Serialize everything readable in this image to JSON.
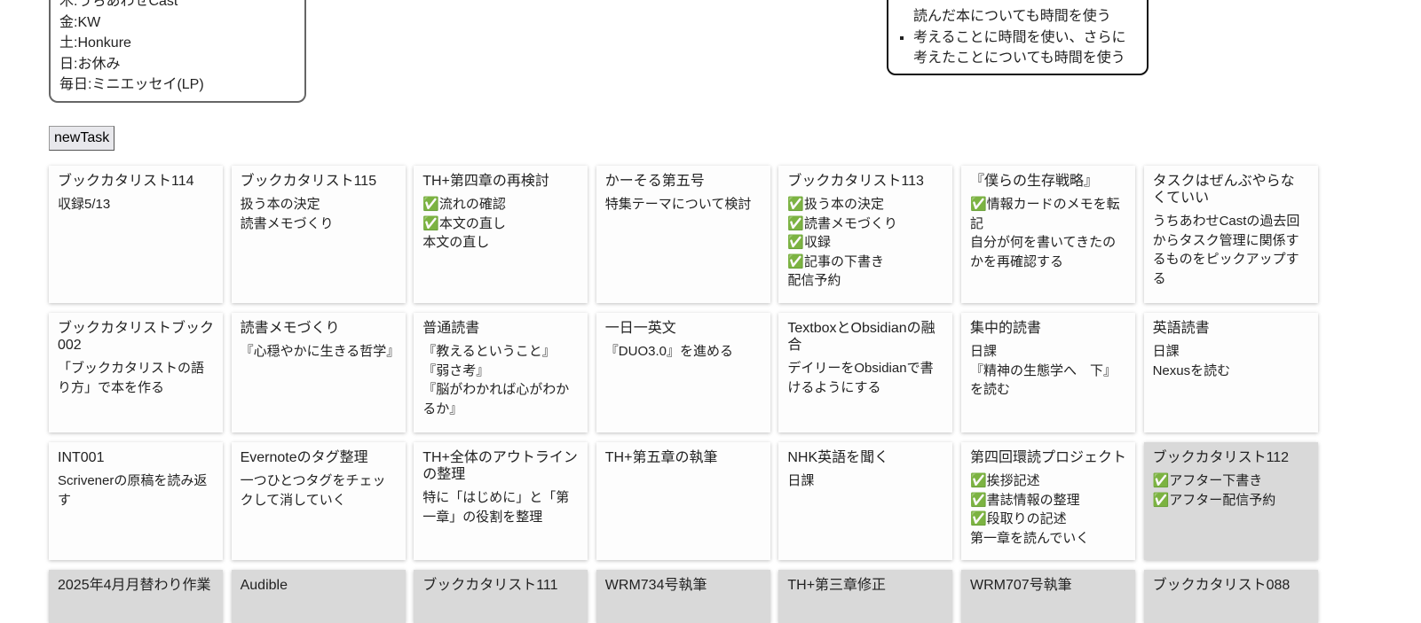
{
  "schedule": [
    "木:うちあわせCast",
    "金:KW",
    "土:Honkure",
    "日:お休み",
    "毎日:ミニエッセイ(LP)"
  ],
  "notes": {
    "cont": "読んだ本についても時間を使う",
    "items": [
      "考えることに時間を使い、さらに考えたことについても時間を使う"
    ]
  },
  "new_task_label": "newTask",
  "cards": [
    {
      "title": "ブックカタリスト114",
      "lines": [
        "収録5/13"
      ],
      "done": false,
      "row": 1
    },
    {
      "title": "ブックカタリスト115",
      "lines": [
        "扱う本の決定",
        "読書メモづくり"
      ],
      "done": false,
      "row": 1
    },
    {
      "title": "TH+第四章の再検討",
      "lines": [
        "✅流れの確認",
        "✅本文の直し",
        "本文の直し"
      ],
      "done": false,
      "row": 1
    },
    {
      "title": "かーそる第五号",
      "lines": [
        "特集テーマについて検討"
      ],
      "done": false,
      "row": 1
    },
    {
      "title": "ブックカタリスト113",
      "lines": [
        "✅扱う本の決定",
        "✅読書メモづくり",
        "✅収録",
        "✅記事の下書き",
        "配信予約"
      ],
      "done": false,
      "row": 1
    },
    {
      "title": "『僕らの生存戦略』",
      "lines": [
        "✅情報カードのメモを転記",
        "自分が何を書いてきたのかを再確認する"
      ],
      "done": false,
      "row": 1
    },
    {
      "title": "タスクはぜんぶやらなくていい",
      "lines": [
        "うちあわせCastの過去回からタスク管理に関係するものをピックアップする"
      ],
      "done": false,
      "row": 1
    },
    {
      "title": "ブックカタリストブック002",
      "lines": [
        "「ブックカタリストの語り方」で本を作る"
      ],
      "done": false,
      "row": 2
    },
    {
      "title": "読書メモづくり",
      "lines": [
        "『心穏やかに生きる哲学』"
      ],
      "done": false,
      "row": 2
    },
    {
      "title": "普通読書",
      "lines": [
        "『教えるということ』",
        "『弱さ考』",
        "『脳がわかれば心がわかるか』"
      ],
      "done": false,
      "row": 2
    },
    {
      "title": "一日一英文",
      "lines": [
        "『DUO3.0』を進める"
      ],
      "done": false,
      "row": 2
    },
    {
      "title": "TextboxとObsidianの融合",
      "lines": [
        "デイリーをObsidianで書けるようにする"
      ],
      "done": false,
      "row": 2
    },
    {
      "title": "集中的読書",
      "lines": [
        "日課",
        "『精神の生態学へ　下』を読む"
      ],
      "done": false,
      "row": 2
    },
    {
      "title": "英語読書",
      "lines": [
        "日課",
        "Nexusを読む"
      ],
      "done": false,
      "row": 2
    },
    {
      "title": "INT001",
      "lines": [
        "Scrivenerの原稿を読み返す"
      ],
      "done": false,
      "row": 3
    },
    {
      "title": "Evernoteのタグ整理",
      "lines": [
        "一つひとつタグをチェックして消していく"
      ],
      "done": false,
      "row": 3
    },
    {
      "title": "TH+全体のアウトラインの整理",
      "lines": [
        "特に「はじめに」と「第一章」の役割を整理"
      ],
      "done": false,
      "row": 3
    },
    {
      "title": "TH+第五章の執筆",
      "lines": [],
      "done": false,
      "row": 3
    },
    {
      "title": "NHK英語を聞く",
      "lines": [
        "日課"
      ],
      "done": false,
      "row": 3
    },
    {
      "title": "第四回環読プロジェクト",
      "lines": [
        "✅挨拶記述",
        "✅書誌情報の整理",
        "✅段取りの記述",
        "第一章を読んでいく"
      ],
      "done": false,
      "row": 3
    },
    {
      "title": "ブックカタリスト112",
      "lines": [
        "✅アフター下書き",
        "✅アフター配信予約"
      ],
      "done": true,
      "row": 3
    },
    {
      "title": "2025年4月月替わり作業",
      "lines": [],
      "done": true,
      "row": 4
    },
    {
      "title": "Audible",
      "lines": [],
      "done": true,
      "row": 4
    },
    {
      "title": "ブックカタリスト111",
      "lines": [],
      "done": true,
      "row": 4
    },
    {
      "title": "WRM734号執筆",
      "lines": [],
      "done": true,
      "row": 4
    },
    {
      "title": "TH+第三章修正",
      "lines": [],
      "done": true,
      "row": 4
    },
    {
      "title": "WRM707号執筆",
      "lines": [],
      "done": true,
      "row": 4
    },
    {
      "title": "ブックカタリスト088",
      "lines": [],
      "done": true,
      "row": 4
    }
  ]
}
